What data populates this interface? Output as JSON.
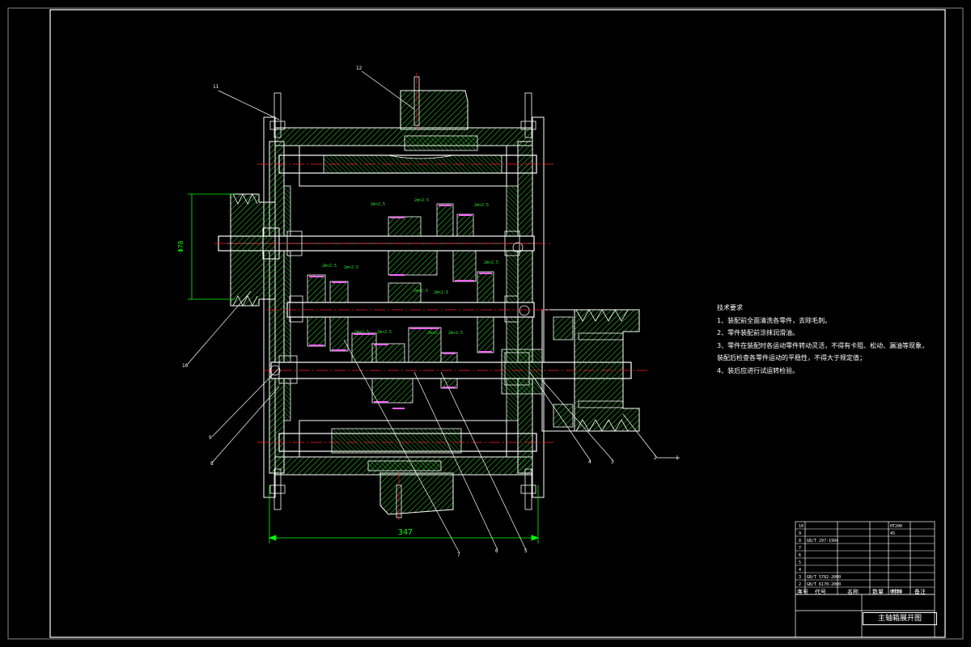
{
  "drawing": {
    "dimension_overall": "347",
    "dimension_pulley": "Φ78",
    "balloons": [
      "11",
      "12",
      "10",
      "9",
      "8",
      "7",
      "6",
      "5",
      "4",
      "3",
      "2",
      "1"
    ],
    "gear_labels": [
      "2m×2.5",
      "2m×2.5",
      "2m×2.5",
      "2m×2.5",
      "2m×2.5",
      "2m×2.5",
      "2m×2.5",
      "2m×2.5",
      "2m×2.5",
      "2m×2.5",
      "2m×2.5",
      "2m×2.5"
    ]
  },
  "notes": {
    "heading": "技术要求",
    "items": [
      "1、装配前全面清洗各零件，去除毛刺。",
      "2、零件装配前涂抹润滑油。",
      "3、零件在装配时各运动零件转动灵活，不得有卡阻、松动、漏油等现象，",
      "   装配后检查各零件运动的平稳性，不得大于规定值；",
      "4、装后应进行试运转检验。"
    ]
  },
  "title_block": {
    "title": "主轴箱展开图",
    "header_cols": [
      "序号",
      "代号",
      "名称",
      "数量",
      "材料",
      "备注"
    ],
    "rows": [
      [
        "10",
        "",
        "",
        "",
        "HT200",
        ""
      ],
      [
        "9",
        "",
        "",
        "",
        "45",
        ""
      ],
      [
        "8",
        "GB/T 297-1994",
        "",
        "",
        "",
        ""
      ],
      [
        "7",
        "",
        "",
        "",
        "",
        ""
      ],
      [
        "6",
        "",
        "",
        "",
        "",
        ""
      ],
      [
        "5",
        "",
        "",
        "",
        "",
        ""
      ],
      [
        "4",
        "",
        "",
        "",
        "",
        ""
      ],
      [
        "3",
        "GB/T 5782-2000",
        "",
        "",
        "",
        ""
      ],
      [
        "2",
        "GB/T 6170-2000",
        "",
        "",
        "",
        ""
      ],
      [
        "1",
        "",
        "",
        "",
        "HT200",
        ""
      ]
    ]
  },
  "colors": {
    "outline": "#ffffff",
    "hatch": "#2ee62e",
    "center": "#ff2020",
    "gear_tip": "#ff66ff",
    "dimension": "#00ff00",
    "label": "#2ee62e"
  }
}
